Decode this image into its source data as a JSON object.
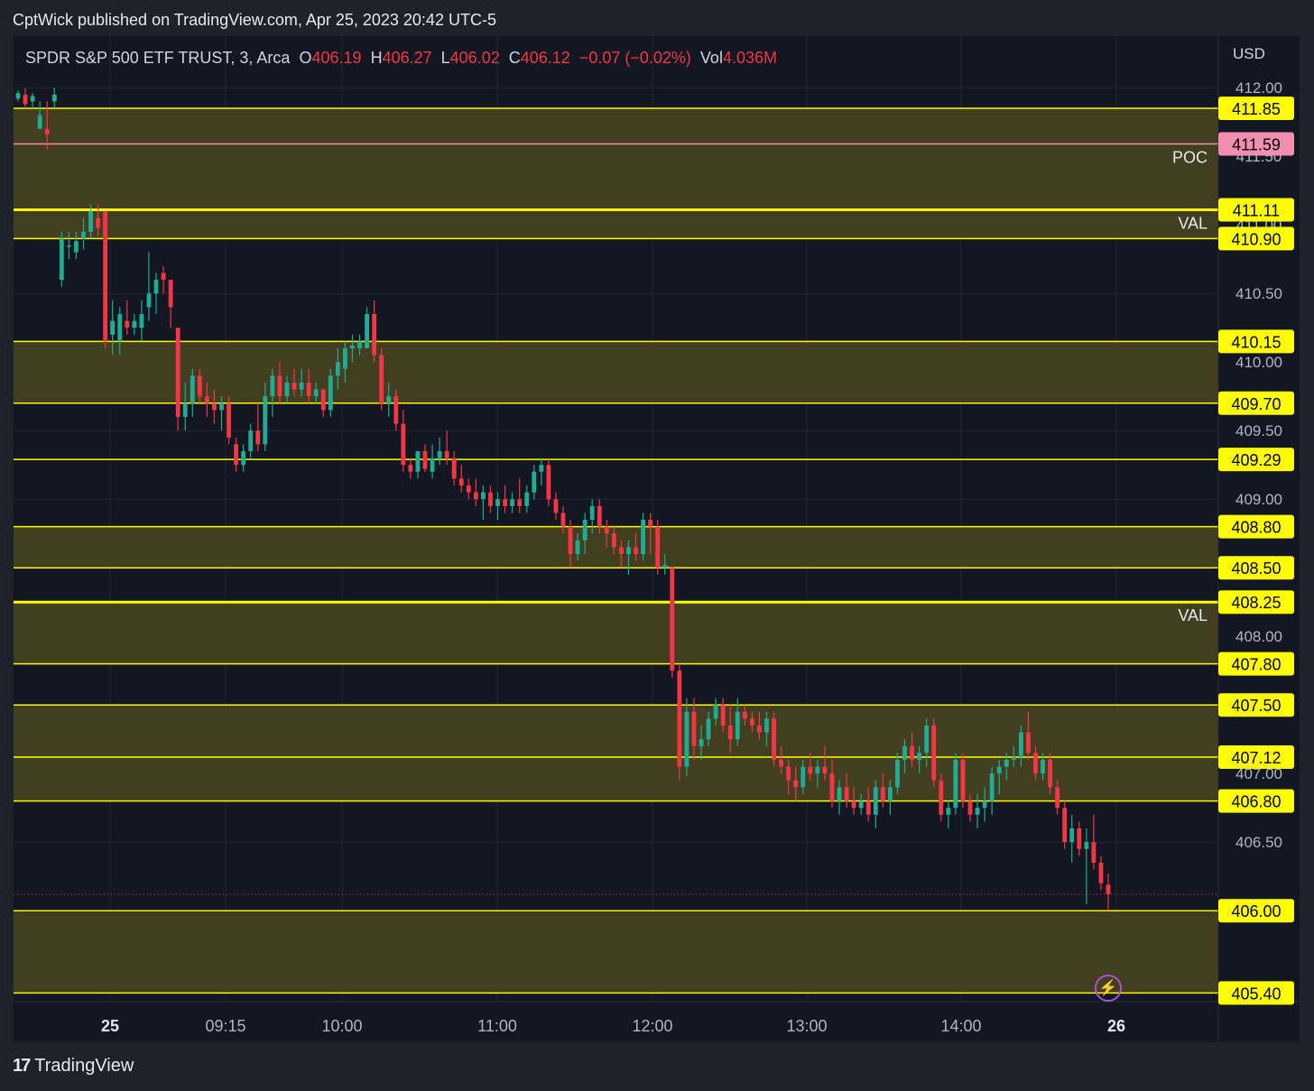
{
  "header": {
    "publisher_text": "CptWick published on TradingView.com, Apr 25, 2023 20:42 UTC-5"
  },
  "legend": {
    "symbol": "SPDR S&P 500 ETF TRUST, 3, Arca",
    "open_label": "O",
    "open": "406.19",
    "high_label": "H",
    "high": "406.27",
    "low_label": "L",
    "low": "406.02",
    "close_label": "C",
    "close": "406.12",
    "change": "−0.07 (−0.02%)",
    "vol_label": "Vol",
    "volume": "4.036M"
  },
  "currency": "USD",
  "footer": {
    "brand": "TradingView",
    "logo_glyph": "17"
  },
  "colors": {
    "background": "#131722",
    "up": "#22ab94",
    "down": "#f23645",
    "level_line": "#ffff00",
    "zone_fill": "#4a4620",
    "poc_line": "#f28fb0",
    "price_badge": "#ffff00",
    "axis_text": "#b2b5be"
  },
  "chart_data": {
    "type": "candlestick",
    "symbol": "SPY",
    "timeframe": "3",
    "ylim": [
      405.35,
      412.1
    ],
    "y_ticks": [
      "412.00",
      "411.50",
      "411.00",
      "410.50",
      "410.00",
      "409.50",
      "409.00",
      "408.00",
      "407.00",
      "406.50"
    ],
    "x_ticks": [
      "25",
      "09:15",
      "10:00",
      "11:00",
      "12:00",
      "13:00",
      "14:00",
      "26"
    ],
    "levels": [
      {
        "price": 411.85,
        "label": "411.85"
      },
      {
        "price": 411.59,
        "label": "411.59",
        "tag": "POC",
        "color": "#f28fb0"
      },
      {
        "price": 411.11,
        "label": "411.11",
        "tag": "VAL",
        "thick": true
      },
      {
        "price": 410.9,
        "label": "410.90"
      },
      {
        "price": 410.15,
        "label": "410.15"
      },
      {
        "price": 409.7,
        "label": "409.70"
      },
      {
        "price": 409.29,
        "label": "409.29"
      },
      {
        "price": 408.8,
        "label": "408.80"
      },
      {
        "price": 408.5,
        "label": "408.50"
      },
      {
        "price": 408.25,
        "label": "408.25",
        "tag": "VAL",
        "thick": true
      },
      {
        "price": 407.8,
        "label": "407.80"
      },
      {
        "price": 407.5,
        "label": "407.50"
      },
      {
        "price": 407.12,
        "label": "407.12"
      },
      {
        "price": 406.8,
        "label": "406.80"
      },
      {
        "price": 406.0,
        "label": "406.00"
      },
      {
        "price": 405.4,
        "label": "405.40"
      }
    ],
    "zones": [
      [
        410.9,
        411.85
      ],
      [
        409.7,
        410.15
      ],
      [
        408.5,
        408.8
      ],
      [
        407.8,
        408.25
      ],
      [
        406.8,
        407.5
      ],
      [
        405.4,
        406.0
      ]
    ],
    "last_price": 406.12,
    "candles": [
      [
        411.92,
        411.98,
        411.9,
        411.96
      ],
      [
        411.95,
        412.0,
        411.85,
        411.88
      ],
      [
        411.9,
        411.96,
        411.85,
        411.94
      ],
      [
        411.7,
        411.9,
        411.7,
        411.8
      ],
      [
        411.7,
        411.9,
        411.55,
        411.66
      ],
      [
        411.9,
        412.0,
        411.85,
        411.95
      ],
      [
        410.6,
        410.95,
        410.55,
        410.9
      ],
      [
        410.85,
        410.95,
        410.75,
        410.85
      ],
      [
        410.8,
        410.95,
        410.75,
        410.88
      ],
      [
        410.9,
        411.05,
        410.82,
        410.95
      ],
      [
        410.95,
        411.15,
        410.9,
        411.1
      ],
      [
        411.05,
        411.15,
        410.92,
        410.98
      ],
      [
        411.1,
        411.1,
        410.1,
        410.15
      ],
      [
        410.2,
        410.45,
        410.05,
        410.3
      ],
      [
        410.15,
        410.4,
        410.05,
        410.35
      ],
      [
        410.3,
        410.45,
        410.2,
        410.25
      ],
      [
        410.25,
        410.35,
        410.2,
        410.3
      ],
      [
        410.25,
        410.45,
        410.15,
        410.35
      ],
      [
        410.4,
        410.8,
        410.3,
        410.5
      ],
      [
        410.5,
        410.65,
        410.35,
        410.6
      ],
      [
        410.65,
        410.7,
        410.5,
        410.6
      ],
      [
        410.6,
        410.6,
        410.25,
        410.4
      ],
      [
        410.25,
        410.25,
        409.5,
        409.6
      ],
      [
        409.6,
        409.85,
        409.5,
        409.7
      ],
      [
        409.7,
        409.95,
        409.6,
        409.9
      ],
      [
        409.9,
        409.95,
        409.7,
        409.75
      ],
      [
        409.75,
        409.85,
        409.6,
        409.7
      ],
      [
        409.7,
        409.8,
        409.55,
        409.65
      ],
      [
        409.65,
        409.75,
        409.5,
        409.7
      ],
      [
        409.7,
        409.75,
        409.4,
        409.45
      ],
      [
        409.4,
        409.45,
        409.2,
        409.25
      ],
      [
        409.25,
        409.4,
        409.2,
        409.35
      ],
      [
        409.35,
        409.55,
        409.3,
        409.5
      ],
      [
        409.5,
        409.7,
        409.35,
        409.4
      ],
      [
        409.4,
        409.85,
        409.35,
        409.75
      ],
      [
        409.75,
        409.95,
        409.6,
        409.9
      ],
      [
        409.9,
        410.0,
        409.7,
        409.75
      ],
      [
        409.75,
        409.9,
        409.7,
        409.85
      ],
      [
        409.85,
        409.95,
        409.75,
        409.8
      ],
      [
        409.8,
        409.95,
        409.75,
        409.85
      ],
      [
        409.85,
        409.95,
        409.7,
        409.75
      ],
      [
        409.75,
        409.85,
        409.7,
        409.8
      ],
      [
        409.8,
        409.8,
        409.6,
        409.65
      ],
      [
        409.65,
        409.95,
        409.6,
        409.9
      ],
      [
        409.9,
        410.1,
        409.8,
        410.0
      ],
      [
        409.95,
        410.15,
        409.85,
        410.1
      ],
      [
        410.1,
        410.2,
        410.0,
        410.12
      ],
      [
        410.1,
        410.2,
        410.05,
        410.15
      ],
      [
        410.1,
        410.4,
        410.1,
        410.35
      ],
      [
        410.35,
        410.45,
        410.0,
        410.05
      ],
      [
        410.05,
        410.1,
        409.65,
        409.7
      ],
      [
        409.7,
        409.85,
        409.6,
        409.75
      ],
      [
        409.75,
        409.8,
        409.5,
        409.55
      ],
      [
        409.55,
        409.65,
        409.2,
        409.25
      ],
      [
        409.25,
        409.3,
        409.15,
        409.2
      ],
      [
        409.2,
        409.3,
        409.15,
        409.35
      ],
      [
        409.35,
        409.4,
        409.2,
        409.22
      ],
      [
        409.2,
        409.4,
        409.15,
        409.3
      ],
      [
        409.3,
        409.45,
        409.25,
        409.35
      ],
      [
        409.35,
        409.5,
        409.25,
        409.3
      ],
      [
        409.3,
        409.35,
        409.1,
        409.15
      ],
      [
        409.15,
        409.25,
        409.05,
        409.1
      ],
      [
        409.1,
        409.15,
        409.0,
        409.05
      ],
      [
        409.05,
        409.15,
        408.95,
        409.0
      ],
      [
        409.0,
        409.1,
        408.85,
        409.05
      ],
      [
        409.05,
        409.1,
        408.9,
        408.95
      ],
      [
        408.95,
        409.05,
        408.85,
        409.0
      ],
      [
        409.0,
        409.1,
        408.9,
        408.95
      ],
      [
        408.95,
        409.05,
        408.9,
        409.0
      ],
      [
        409.0,
        409.15,
        408.9,
        408.95
      ],
      [
        408.95,
        409.1,
        408.9,
        409.05
      ],
      [
        409.05,
        409.25,
        409.0,
        409.2
      ],
      [
        409.2,
        409.3,
        409.1,
        409.25
      ],
      [
        409.25,
        409.3,
        408.95,
        409.0
      ],
      [
        409.0,
        409.05,
        408.85,
        408.9
      ],
      [
        408.9,
        408.95,
        408.75,
        408.8
      ],
      [
        408.8,
        408.85,
        408.5,
        408.6
      ],
      [
        408.6,
        408.75,
        408.55,
        408.7
      ],
      [
        408.7,
        408.9,
        408.6,
        408.85
      ],
      [
        408.85,
        409.0,
        408.75,
        408.95
      ],
      [
        408.95,
        409.0,
        408.75,
        408.8
      ],
      [
        408.8,
        408.85,
        408.65,
        408.75
      ],
      [
        408.75,
        408.8,
        408.6,
        408.65
      ],
      [
        408.65,
        408.7,
        408.5,
        408.6
      ],
      [
        408.6,
        408.7,
        408.45,
        408.65
      ],
      [
        408.65,
        408.75,
        408.55,
        408.6
      ],
      [
        408.6,
        408.9,
        408.55,
        408.85
      ],
      [
        408.85,
        408.9,
        408.6,
        408.8
      ],
      [
        408.8,
        408.85,
        408.45,
        408.5
      ],
      [
        408.5,
        408.6,
        408.45,
        408.52
      ],
      [
        408.5,
        408.5,
        407.7,
        407.75
      ],
      [
        407.75,
        407.8,
        406.95,
        407.05
      ],
      [
        407.05,
        407.55,
        406.98,
        407.45
      ],
      [
        407.45,
        407.55,
        407.1,
        407.2
      ],
      [
        407.2,
        407.35,
        407.1,
        407.25
      ],
      [
        407.25,
        407.45,
        407.2,
        407.4
      ],
      [
        407.4,
        407.55,
        407.35,
        407.5
      ],
      [
        407.5,
        407.55,
        407.3,
        407.35
      ],
      [
        407.35,
        407.5,
        407.15,
        407.25
      ],
      [
        407.25,
        407.55,
        407.2,
        407.45
      ],
      [
        407.45,
        407.5,
        407.35,
        407.4
      ],
      [
        407.4,
        407.45,
        407.3,
        407.35
      ],
      [
        407.35,
        407.45,
        407.25,
        407.3
      ],
      [
        407.3,
        407.45,
        407.2,
        407.4
      ],
      [
        407.4,
        407.45,
        407.05,
        407.1
      ],
      [
        407.1,
        407.2,
        407.0,
        407.05
      ],
      [
        407.05,
        407.1,
        406.85,
        406.95
      ],
      [
        406.95,
        407.05,
        406.8,
        406.9
      ],
      [
        406.9,
        407.1,
        406.85,
        407.05
      ],
      [
        407.05,
        407.15,
        406.95,
        407.0
      ],
      [
        407.0,
        407.1,
        406.9,
        407.05
      ],
      [
        407.05,
        407.2,
        406.95,
        407.0
      ],
      [
        407.0,
        407.1,
        406.75,
        406.8
      ],
      [
        406.8,
        406.95,
        406.7,
        406.9
      ],
      [
        406.9,
        407.0,
        406.75,
        406.8
      ],
      [
        406.8,
        406.9,
        406.7,
        406.75
      ],
      [
        406.75,
        406.85,
        406.7,
        406.8
      ],
      [
        406.8,
        406.9,
        406.65,
        406.7
      ],
      [
        406.7,
        406.95,
        406.6,
        406.9
      ],
      [
        406.9,
        407.0,
        406.75,
        406.8
      ],
      [
        406.8,
        406.95,
        406.7,
        406.9
      ],
      [
        406.9,
        407.15,
        406.85,
        407.1
      ],
      [
        407.1,
        407.25,
        407.0,
        407.2
      ],
      [
        407.2,
        407.3,
        407.05,
        407.1
      ],
      [
        407.1,
        407.2,
        407.0,
        407.15
      ],
      [
        407.15,
        407.4,
        407.05,
        407.35
      ],
      [
        407.35,
        407.4,
        406.9,
        406.95
      ],
      [
        406.95,
        407.0,
        406.65,
        406.7
      ],
      [
        406.7,
        406.8,
        406.6,
        406.75
      ],
      [
        406.75,
        407.15,
        406.7,
        407.1
      ],
      [
        407.1,
        407.15,
        406.75,
        406.8
      ],
      [
        406.8,
        406.85,
        406.65,
        406.7
      ],
      [
        406.7,
        406.85,
        406.6,
        406.75
      ],
      [
        406.75,
        406.9,
        406.65,
        406.8
      ],
      [
        406.8,
        407.05,
        406.7,
        407.0
      ],
      [
        407.0,
        407.1,
        406.85,
        407.05
      ],
      [
        407.05,
        407.15,
        406.95,
        407.1
      ],
      [
        407.1,
        407.2,
        407.05,
        407.12
      ],
      [
        407.12,
        407.35,
        407.05,
        407.3
      ],
      [
        407.3,
        407.45,
        407.1,
        407.15
      ],
      [
        407.15,
        407.2,
        406.95,
        407.0
      ],
      [
        407.0,
        407.15,
        406.95,
        407.1
      ],
      [
        407.1,
        407.15,
        406.85,
        406.9
      ],
      [
        406.9,
        406.95,
        406.7,
        406.75
      ],
      [
        406.75,
        406.8,
        406.45,
        406.5
      ],
      [
        406.5,
        406.7,
        406.35,
        406.6
      ],
      [
        406.6,
        406.65,
        406.4,
        406.45
      ],
      [
        406.45,
        406.6,
        406.05,
        406.5
      ],
      [
        406.5,
        406.7,
        406.3,
        406.35
      ],
      [
        406.35,
        406.4,
        406.15,
        406.2
      ],
      [
        406.19,
        406.27,
        406.0,
        406.12
      ]
    ]
  }
}
